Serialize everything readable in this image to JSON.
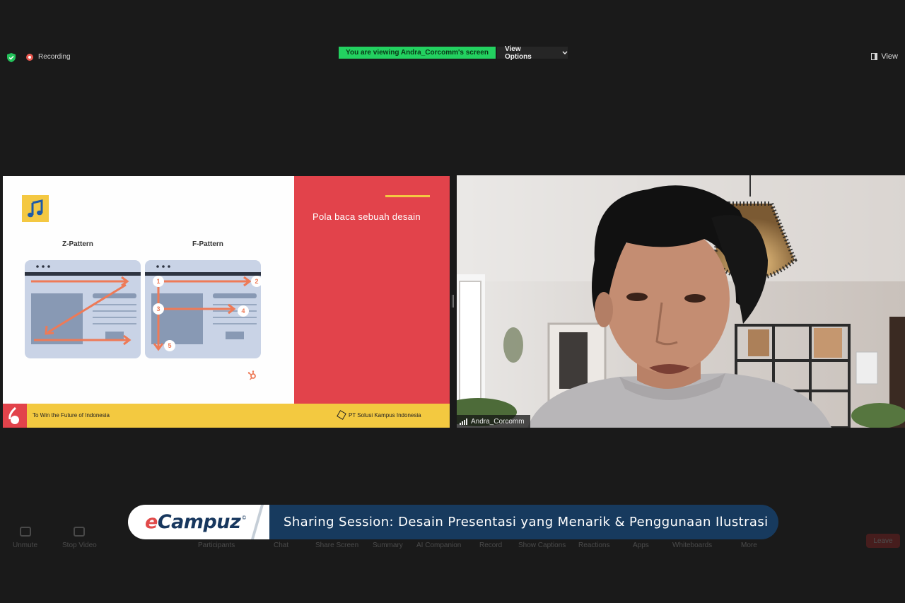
{
  "top": {
    "recording_label": "Recording",
    "viewing_banner": "You are viewing Andra_Corcomm's screen",
    "view_options_label": "View Options",
    "view_label": "View"
  },
  "slide": {
    "panel_title": "Pola baca sebuah desain",
    "z_pattern_title": "Z-Pattern",
    "f_pattern_title": "F-Pattern",
    "f_steps": [
      "1",
      "2",
      "3",
      "4",
      "5"
    ],
    "footer_tagline": "To Win the Future of Indonesia",
    "footer_company": "PT Solusi Kampus Indonesia",
    "colors": {
      "red": "#e2434b",
      "yellow": "#f4c842",
      "arrow": "#ee7a57",
      "window": "#c9d3e6",
      "block": "#8899b4"
    }
  },
  "camera": {
    "participant_name": "Andra_Corcomm"
  },
  "toolbar": {
    "items": [
      {
        "label": "Unmute"
      },
      {
        "label": "Stop Video"
      },
      {
        "label": "Participants"
      },
      {
        "label": "Chat"
      },
      {
        "label": "Share Screen"
      },
      {
        "label": "Summary"
      },
      {
        "label": "AI Companion"
      },
      {
        "label": "Record"
      },
      {
        "label": "Show Captions"
      },
      {
        "label": "Reactions"
      },
      {
        "label": "Apps"
      },
      {
        "label": "Whiteboards"
      },
      {
        "label": "More"
      }
    ],
    "leave_label": "Leave"
  },
  "banner": {
    "logo_e": "e",
    "logo_rest": "Campuz",
    "logo_mark": "©",
    "title": "Sharing Session: Desain Presentasi yang Menarik & Penggunaan Ilustrasi"
  }
}
